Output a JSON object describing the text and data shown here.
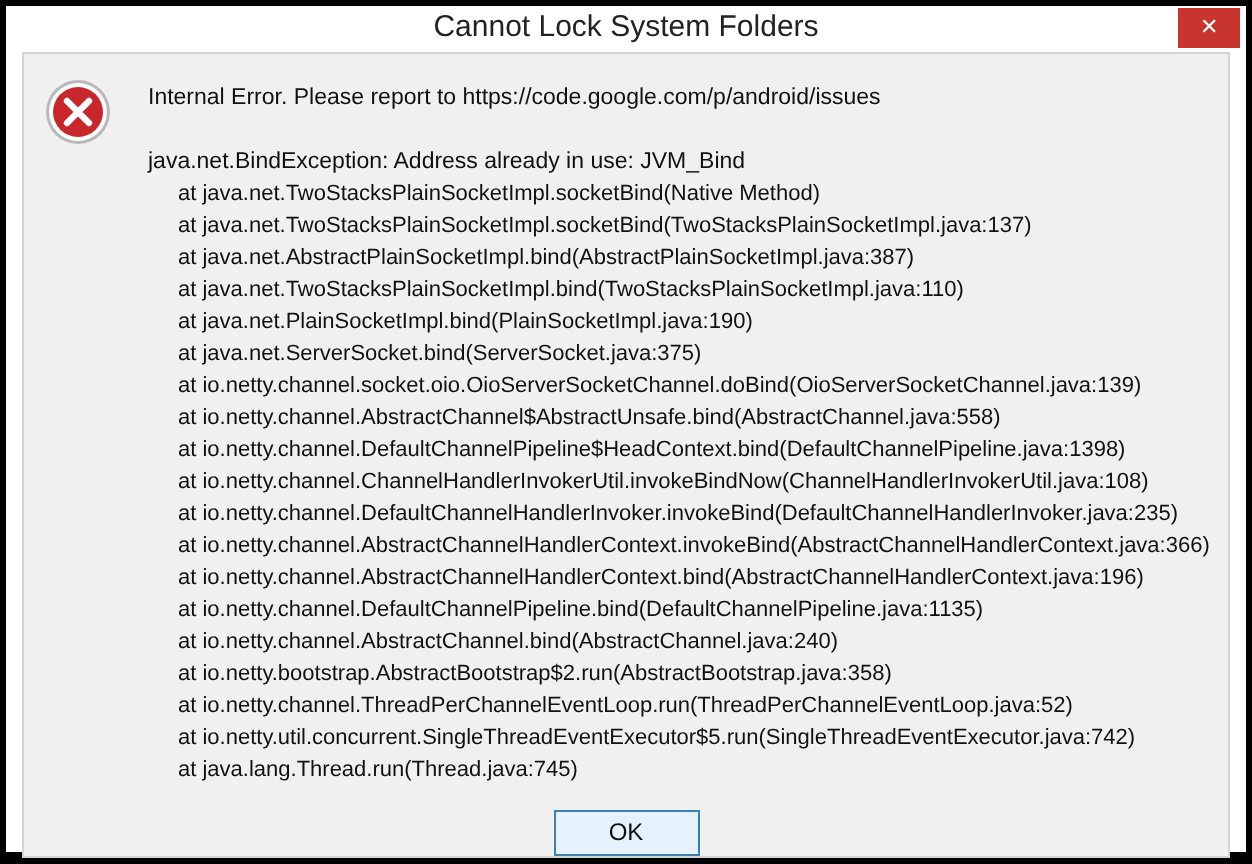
{
  "window": {
    "title": "Cannot Lock System Folders",
    "close_label": "✕"
  },
  "message": "Internal Error. Please report to https://code.google.com/p/android/issues",
  "exception": "java.net.BindException: Address already in use: JVM_Bind",
  "stack_trace": [
    "at java.net.TwoStacksPlainSocketImpl.socketBind(Native Method)",
    "at java.net.TwoStacksPlainSocketImpl.socketBind(TwoStacksPlainSocketImpl.java:137)",
    "at java.net.AbstractPlainSocketImpl.bind(AbstractPlainSocketImpl.java:387)",
    "at java.net.TwoStacksPlainSocketImpl.bind(TwoStacksPlainSocketImpl.java:110)",
    "at java.net.PlainSocketImpl.bind(PlainSocketImpl.java:190)",
    "at java.net.ServerSocket.bind(ServerSocket.java:375)",
    "at io.netty.channel.socket.oio.OioServerSocketChannel.doBind(OioServerSocketChannel.java:139)",
    "at io.netty.channel.AbstractChannel$AbstractUnsafe.bind(AbstractChannel.java:558)",
    "at io.netty.channel.DefaultChannelPipeline$HeadContext.bind(DefaultChannelPipeline.java:1398)",
    "at io.netty.channel.ChannelHandlerInvokerUtil.invokeBindNow(ChannelHandlerInvokerUtil.java:108)",
    "at io.netty.channel.DefaultChannelHandlerInvoker.invokeBind(DefaultChannelHandlerInvoker.java:235)",
    "at io.netty.channel.AbstractChannelHandlerContext.invokeBind(AbstractChannelHandlerContext.java:366)",
    "at io.netty.channel.AbstractChannelHandlerContext.bind(AbstractChannelHandlerContext.java:196)",
    "at io.netty.channel.DefaultChannelPipeline.bind(DefaultChannelPipeline.java:1135)",
    "at io.netty.channel.AbstractChannel.bind(AbstractChannel.java:240)",
    "at io.netty.bootstrap.AbstractBootstrap$2.run(AbstractBootstrap.java:358)",
    "at io.netty.channel.ThreadPerChannelEventLoop.run(ThreadPerChannelEventLoop.java:52)",
    "at io.netty.util.concurrent.SingleThreadEventExecutor$5.run(SingleThreadEventExecutor.java:742)",
    "at java.lang.Thread.run(Thread.java:745)"
  ],
  "buttons": [
    {
      "label": "OK",
      "selected": true
    }
  ]
}
